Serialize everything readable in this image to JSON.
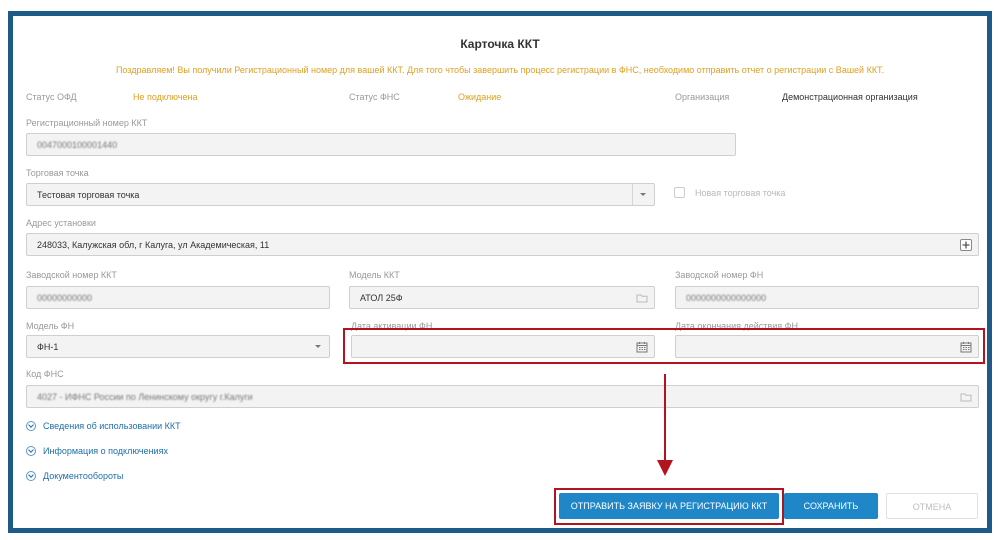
{
  "card": {
    "title": "Карточка ККТ",
    "notice": "Поздравляем! Вы получили Регистрационный номер для вашей ККТ. Для того чтобы завершить процесс регистрации в ФНС, необходимо отправить отчет о регистрации с Вашей ККТ."
  },
  "status": {
    "ofd_label": "Статус ОФД",
    "ofd_value": "Не подключена",
    "fns_label": "Статус ФНС",
    "fns_value": "Ожидание",
    "org_label": "Организация",
    "org_value": "Демонстрационная организация"
  },
  "fields": {
    "reg_number": {
      "label": "Регистрационный номер ККТ",
      "value": "0047000100001440"
    },
    "point": {
      "label": "Торговая точка",
      "value": "Тестовая торговая точка",
      "new_label": "Новая торговая точка"
    },
    "address": {
      "label": "Адрес установки",
      "value": "248033, Калужская обл, г Калуга, ул Академическая, 11"
    },
    "serial": {
      "label": "Заводской номер ККТ",
      "value": "00000000000"
    },
    "model": {
      "label": "Модель ККТ",
      "value": "АТОЛ 25Ф"
    },
    "fn_serial": {
      "label": "Заводской номер ФН",
      "value": "0000000000000000"
    },
    "fn_model": {
      "label": "Модель ФН",
      "value": "ФН-1"
    },
    "fn_activation": {
      "label": "Дата активации ФН",
      "value": ""
    },
    "fn_expiry": {
      "label": "Дата окончания действия ФН",
      "value": ""
    },
    "fns_code": {
      "label": "Код ФНС",
      "value": "4027 - ИФНС России по Ленинскому округу г.Калуги"
    }
  },
  "links": {
    "usage": "Сведения об использовании ККТ",
    "connection": "Информация о подключениях",
    "docflow": "Документообороты"
  },
  "buttons": {
    "register": "ОТПРАВИТЬ ЗАЯВКУ НА РЕГИСТРАЦИЮ ККТ",
    "save": "СОХРАНИТЬ",
    "cancel": "ОТМЕНА"
  },
  "colors": {
    "frame": "#1e5a88",
    "notice": "#e0a020",
    "primary": "#1f86c8",
    "highlight": "#b3121f"
  }
}
